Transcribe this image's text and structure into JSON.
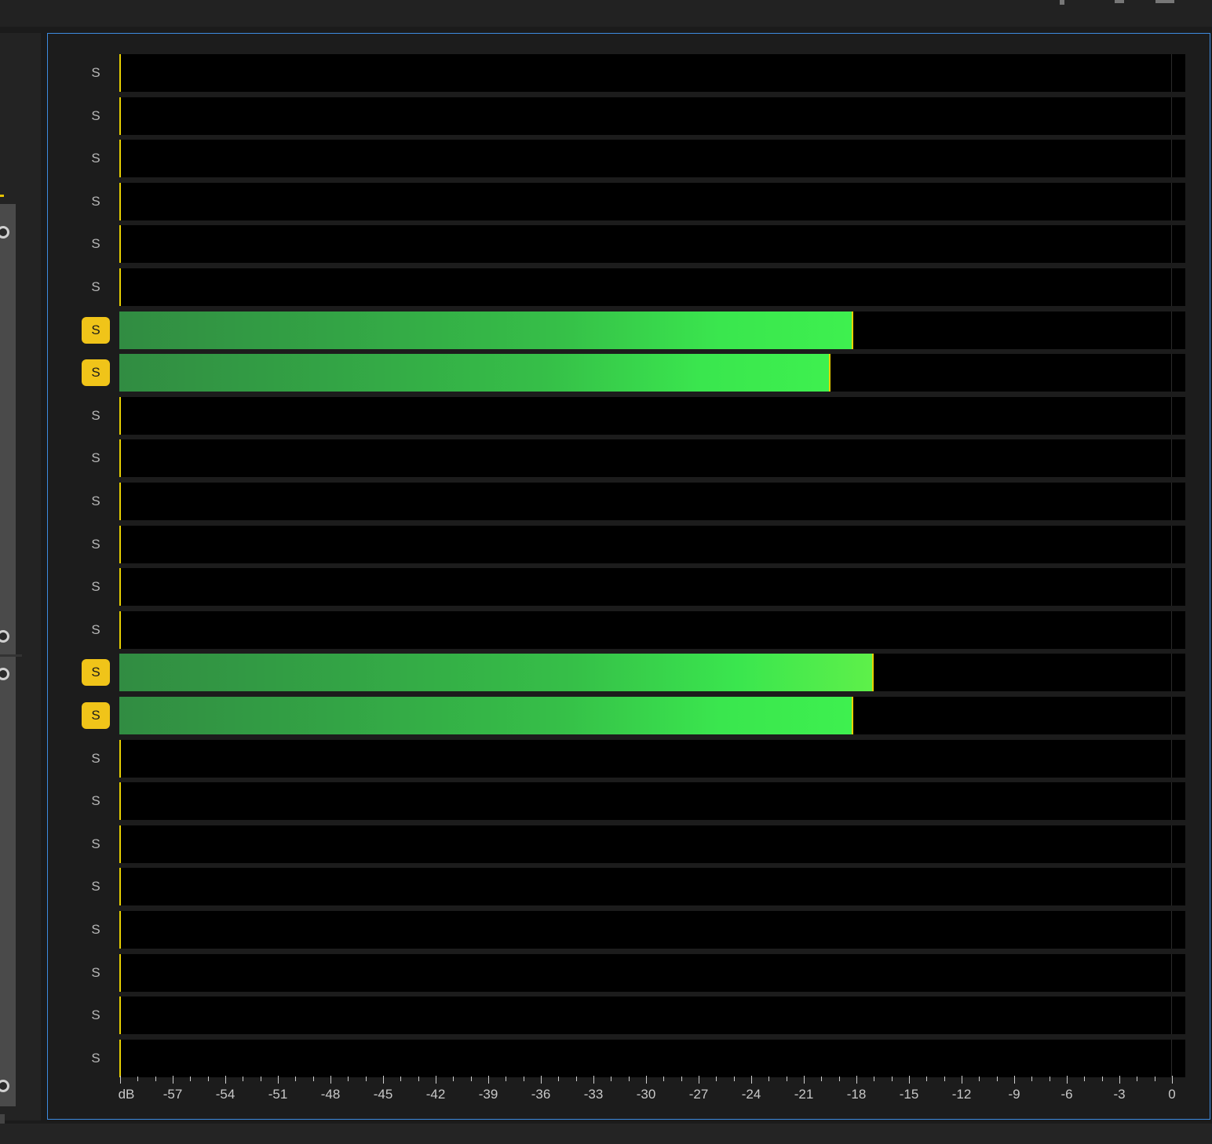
{
  "meter": {
    "solo_label": "S",
    "db_range": [
      -60,
      0
    ],
    "channels": [
      {
        "solo": false,
        "level_db": null
      },
      {
        "solo": false,
        "level_db": null
      },
      {
        "solo": false,
        "level_db": null
      },
      {
        "solo": false,
        "level_db": null
      },
      {
        "solo": false,
        "level_db": null
      },
      {
        "solo": false,
        "level_db": null
      },
      {
        "solo": true,
        "level_db": -18.2
      },
      {
        "solo": true,
        "level_db": -19.5
      },
      {
        "solo": false,
        "level_db": null
      },
      {
        "solo": false,
        "level_db": null
      },
      {
        "solo": false,
        "level_db": null
      },
      {
        "solo": false,
        "level_db": null
      },
      {
        "solo": false,
        "level_db": null
      },
      {
        "solo": false,
        "level_db": null
      },
      {
        "solo": true,
        "level_db": -17.0
      },
      {
        "solo": true,
        "level_db": -18.2
      },
      {
        "solo": false,
        "level_db": null
      },
      {
        "solo": false,
        "level_db": null
      },
      {
        "solo": false,
        "level_db": null
      },
      {
        "solo": false,
        "level_db": null
      },
      {
        "solo": false,
        "level_db": null
      },
      {
        "solo": false,
        "level_db": null
      },
      {
        "solo": false,
        "level_db": null
      },
      {
        "solo": false,
        "level_db": null
      }
    ],
    "axis_labels": [
      "dB",
      "-57",
      "-54",
      "-51",
      "-48",
      "-45",
      "-42",
      "-39",
      "-36",
      "-33",
      "-30",
      "-27",
      "-24",
      "-21",
      "-18",
      "-15",
      "-12",
      "-9",
      "-6",
      "-3",
      "0"
    ]
  },
  "colors": {
    "solo_active": "#f0c419",
    "meter_green": "#3ef04f",
    "peak_yellow": "#e8d000",
    "panel_focus_border": "#3d8be0"
  }
}
